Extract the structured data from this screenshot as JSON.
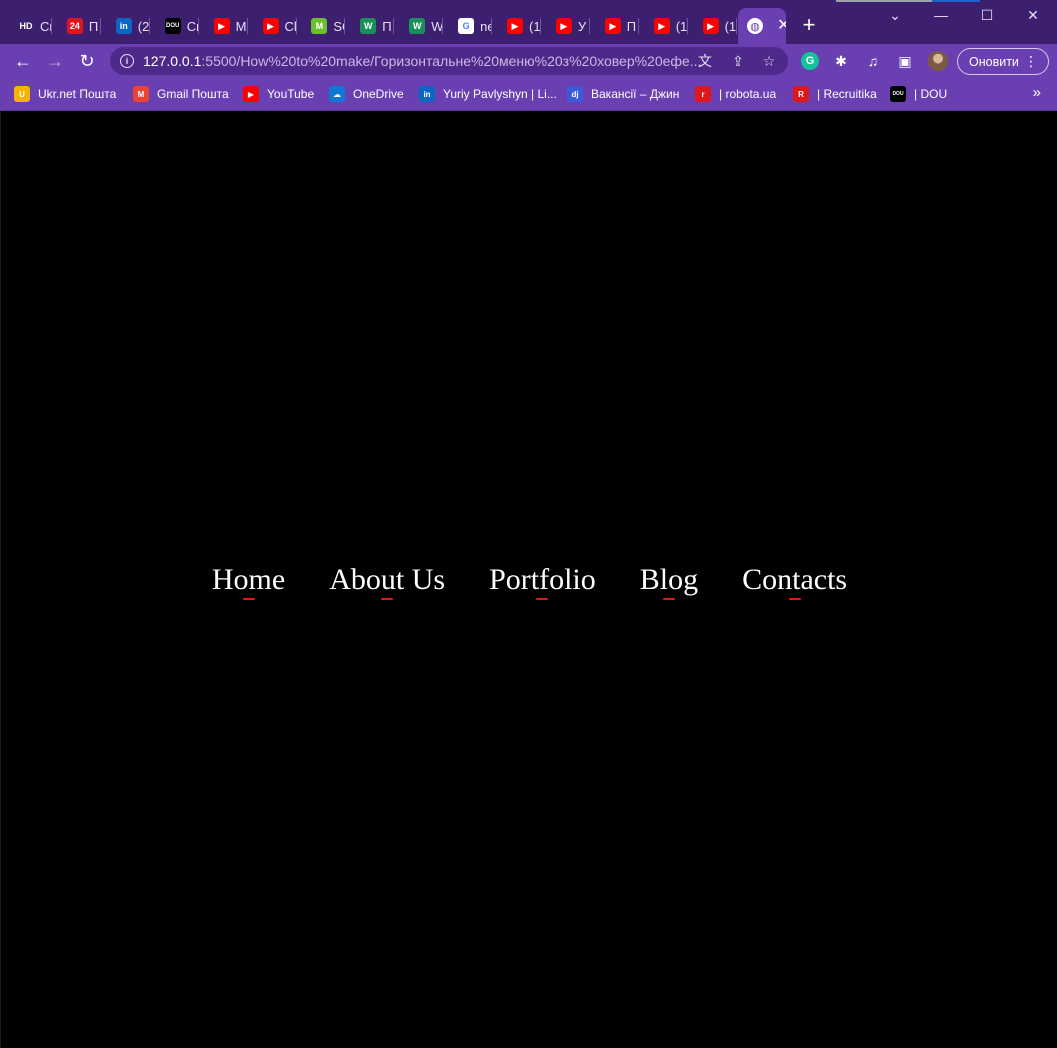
{
  "tabs": [
    {
      "favicon": "hd-icon",
      "fav_text": "HD",
      "fav_color": "#3c1f6e",
      "title": "Ск"
    },
    {
      "favicon": "24-icon",
      "fav_text": "24",
      "fav_color": "#e0161b",
      "title": "П"
    },
    {
      "favicon": "linkedin-icon",
      "fav_text": "in",
      "fav_color": "#0a66c2",
      "title": "(2"
    },
    {
      "favicon": "dou-icon",
      "fav_text": "DOU",
      "fav_color": "#000000",
      "title": "Ск"
    },
    {
      "favicon": "youtube-icon",
      "fav_text": "▶",
      "fav_color": "#ff0000",
      "title": "М"
    },
    {
      "favicon": "youtube-icon",
      "fav_text": "▶",
      "fav_color": "#ff0000",
      "title": "Cl"
    },
    {
      "favicon": "m-icon",
      "fav_text": "M",
      "fav_color": "#6abf2c",
      "title": "SC"
    },
    {
      "favicon": "w-icon",
      "fav_text": "W",
      "fav_color": "#1a8f5a",
      "title": "П"
    },
    {
      "favicon": "w-icon",
      "fav_text": "W",
      "fav_color": "#1a8f5a",
      "title": "W"
    },
    {
      "favicon": "google-icon",
      "fav_text": "G",
      "fav_color": "#ffffff",
      "title": "ne"
    },
    {
      "favicon": "youtube-icon",
      "fav_text": "▶",
      "fav_color": "#ff0000",
      "title": "(1"
    },
    {
      "favicon": "youtube-icon",
      "fav_text": "▶",
      "fav_color": "#ff0000",
      "title": "У"
    },
    {
      "favicon": "youtube-icon",
      "fav_text": "▶",
      "fav_color": "#ff0000",
      "title": "П"
    },
    {
      "favicon": "youtube-icon",
      "fav_text": "▶",
      "fav_color": "#ff0000",
      "title": "(1"
    },
    {
      "favicon": "youtube-icon",
      "fav_text": "▶",
      "fav_color": "#ff0000",
      "title": "(1"
    }
  ],
  "active_tab": {
    "favicon": "globe-icon",
    "close": "✕"
  },
  "new_tab": "+",
  "window": {
    "minimize": "—",
    "maximize": "☐",
    "close": "✕"
  },
  "url": {
    "host": "127.0.0.1",
    "path": ":5500/How%20to%20make/Горизонтальне%20меню%20з%20ховер%20ефе..."
  },
  "update_button": "Оновити",
  "bookmarks": [
    {
      "icon": "ukrnet-icon",
      "fav_text": "U",
      "fav_color": "#f4b400",
      "label": "Ukr.net Пошта"
    },
    {
      "icon": "gmail-icon",
      "fav_text": "M",
      "fav_color": "#ea4335",
      "label": "Gmail Пошта"
    },
    {
      "icon": "youtube-icon",
      "fav_text": "▶",
      "fav_color": "#ff0000",
      "label": "YouTube"
    },
    {
      "icon": "onedrive-icon",
      "fav_text": "☁",
      "fav_color": "#0f78d4",
      "label": "OneDrive"
    },
    {
      "icon": "linkedin-icon",
      "fav_text": "in",
      "fav_color": "#0a66c2",
      "label": "Yuriy Pavlyshyn | Li..."
    },
    {
      "icon": "djinni-icon",
      "fav_text": "dj",
      "fav_color": "#3b5bdb",
      "label": "Вакансії – Джин"
    },
    {
      "icon": "robota-icon",
      "fav_text": "r",
      "fav_color": "#e0161b",
      "label": "| robota.ua"
    },
    {
      "icon": "recruitika-icon",
      "fav_text": "R",
      "fav_color": "#e0161b",
      "label": "| Recruitika"
    },
    {
      "icon": "dou-icon",
      "fav_text": "DOU",
      "fav_color": "#000000",
      "label": "| DOU"
    }
  ],
  "bookmarks_more": "»",
  "menu": {
    "items": [
      "Home",
      "About Us",
      "Portfolio",
      "Blog",
      "Contacts"
    ],
    "text_color": "#ffffff",
    "underline_color": "#e0161b",
    "background": "#000000"
  }
}
